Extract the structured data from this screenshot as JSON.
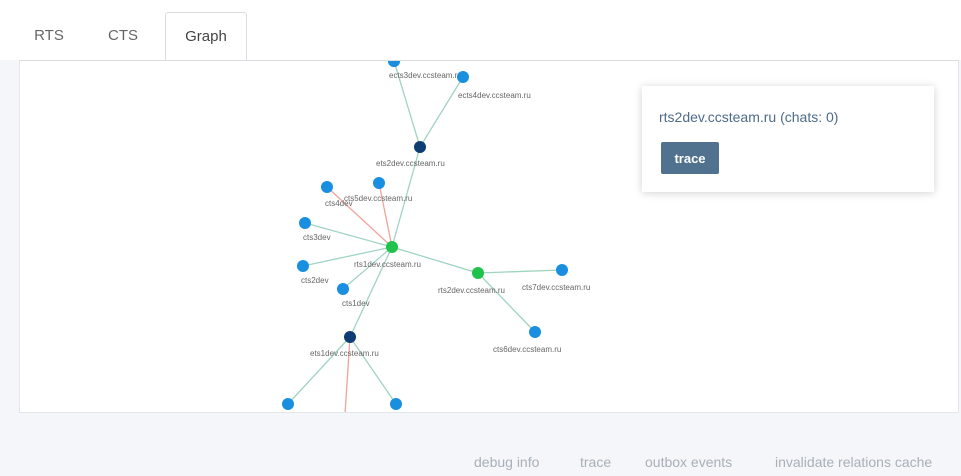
{
  "tabs": [
    {
      "label": "RTS",
      "active": false
    },
    {
      "label": "CTS",
      "active": false
    },
    {
      "label": "Graph",
      "active": true
    }
  ],
  "graph": {
    "nodes": [
      {
        "id": "n_top",
        "label": "",
        "color": "#1a8fe0"
      },
      {
        "id": "ects3",
        "label": "ects3dev.ccsteam.ru",
        "color": "#1a8fe0"
      },
      {
        "id": "ects4",
        "label": "ects4dev.ccsteam.ru",
        "color": "#1a8fe0"
      },
      {
        "id": "ets2",
        "label": "ets2dev.ccsteam.ru",
        "color": "#0d3d72"
      },
      {
        "id": "cts4",
        "label": "cts4dev",
        "color": "#1a8fe0"
      },
      {
        "id": "cts5",
        "label": "cts5dev.ccsteam.ru",
        "color": "#1a8fe0"
      },
      {
        "id": "cts3",
        "label": "cts3dev",
        "color": "#1a8fe0"
      },
      {
        "id": "rts1",
        "label": "rts1dev.ccsteam.ru",
        "color": "#1fc24a"
      },
      {
        "id": "cts2",
        "label": "cts2dev",
        "color": "#1a8fe0"
      },
      {
        "id": "cts1",
        "label": "cts1dev",
        "color": "#1a8fe0"
      },
      {
        "id": "rts2",
        "label": "rts2dev.ccsteam.ru",
        "color": "#1fc24a"
      },
      {
        "id": "cts7",
        "label": "cts7dev.ccsteam.ru",
        "color": "#1a8fe0"
      },
      {
        "id": "cts6",
        "label": "cts6dev.ccsteam.ru",
        "color": "#1a8fe0"
      },
      {
        "id": "ets1",
        "label": "ets1dev.ccsteam.ru",
        "color": "#0d3d72"
      },
      {
        "id": "b1",
        "label": "",
        "color": "#1a8fe0"
      },
      {
        "id": "b2",
        "label": "",
        "color": "#1a8fe0"
      }
    ],
    "edges": [
      {
        "from": "ets2",
        "to": "ects3",
        "color": "#9fd4be"
      },
      {
        "from": "ets2",
        "to": "ects4",
        "color": "#9fd4be"
      },
      {
        "from": "rts1",
        "to": "ets2",
        "color": "#9fd4be"
      },
      {
        "from": "rts1",
        "to": "cts4",
        "color": "#f0a39a"
      },
      {
        "from": "rts1",
        "to": "cts5",
        "color": "#f0a39a"
      },
      {
        "from": "rts1",
        "to": "cts3",
        "color": "#9fd4be"
      },
      {
        "from": "rts1",
        "to": "cts2",
        "color": "#9fd4be"
      },
      {
        "from": "rts1",
        "to": "cts1",
        "color": "#9fd4be"
      },
      {
        "from": "rts1",
        "to": "rts2",
        "color": "#9fd4be"
      },
      {
        "from": "rts2",
        "to": "cts7",
        "color": "#9fd4be"
      },
      {
        "from": "rts2",
        "to": "cts6",
        "color": "#9fd4be"
      },
      {
        "from": "rts1",
        "to": "ets1",
        "color": "#9fd4be"
      },
      {
        "from": "ets1",
        "to": "b1",
        "color": "#9fd4be"
      },
      {
        "from": "ets1",
        "to": "b2",
        "color": "#9fd4be"
      },
      {
        "from": "ets1",
        "to": "b_down",
        "color": "#f0a39a"
      }
    ]
  },
  "info": {
    "title": "rts2dev.ccsteam.ru (chats: 0)",
    "trace_label": "trace"
  },
  "footer": {
    "links": [
      "debug info",
      "trace",
      "outbox events",
      "invalidate relations cache"
    ]
  },
  "colors": {
    "accent": "#51728f",
    "rts_node": "#1fc24a",
    "cts_node": "#1a8fe0",
    "ets_node": "#0d3d72",
    "edge_ok": "#9fd4be",
    "edge_warn": "#f0a39a"
  }
}
